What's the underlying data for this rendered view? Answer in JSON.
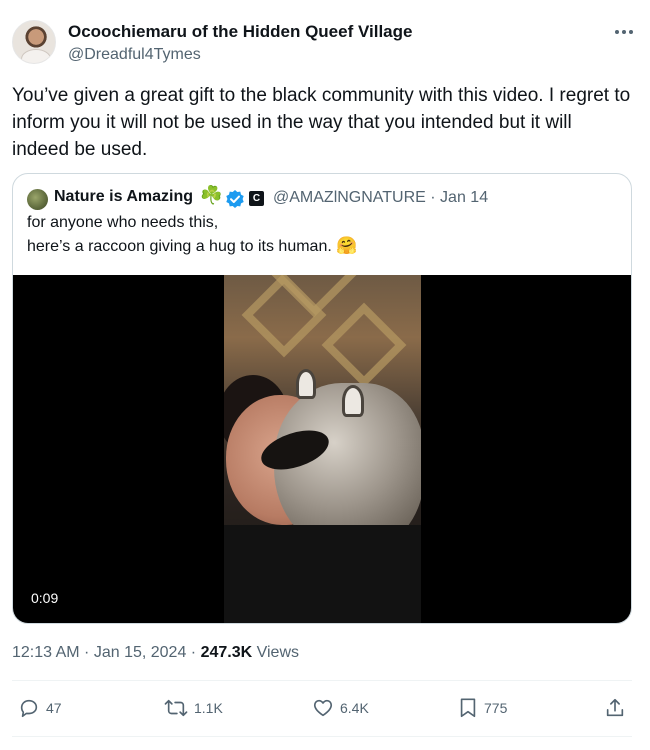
{
  "author": {
    "name": "Ocoochiemaru of the Hidden Queef Village",
    "handle": "@Dreadful4Tymes"
  },
  "tweet_text": "You’ve given a great gift to the black community with this video. I regret to inform you it will not be used in the way that you intended but it will indeed be used.",
  "quoted": {
    "name": "Nature is Amazing",
    "name_emoji": "☘️",
    "badge_letter": "C",
    "meta": "@AMAZlNGNATURE · Jan 14",
    "text_line1": "for anyone who needs this,",
    "text_line2": "here’s a raccoon giving a hug to its human.",
    "text_emoji": "🤗",
    "video_duration": "0:09"
  },
  "timestamp": {
    "time_date": "12:13 AM · Jan 15, 2024 · ",
    "views_count": "247.3K",
    "views_label": " Views"
  },
  "actions": {
    "replies": "47",
    "reposts": "1.1K",
    "likes": "6.4K",
    "bookmarks": "775"
  },
  "colors": {
    "text_primary": "#0f1419",
    "text_secondary": "#536471",
    "verified_blue": "#1d9bf0",
    "border": "#cfd9de"
  },
  "icons": [
    "more-icon",
    "verified-icon",
    "reply-icon",
    "repost-icon",
    "like-icon",
    "bookmark-icon",
    "share-icon"
  ]
}
